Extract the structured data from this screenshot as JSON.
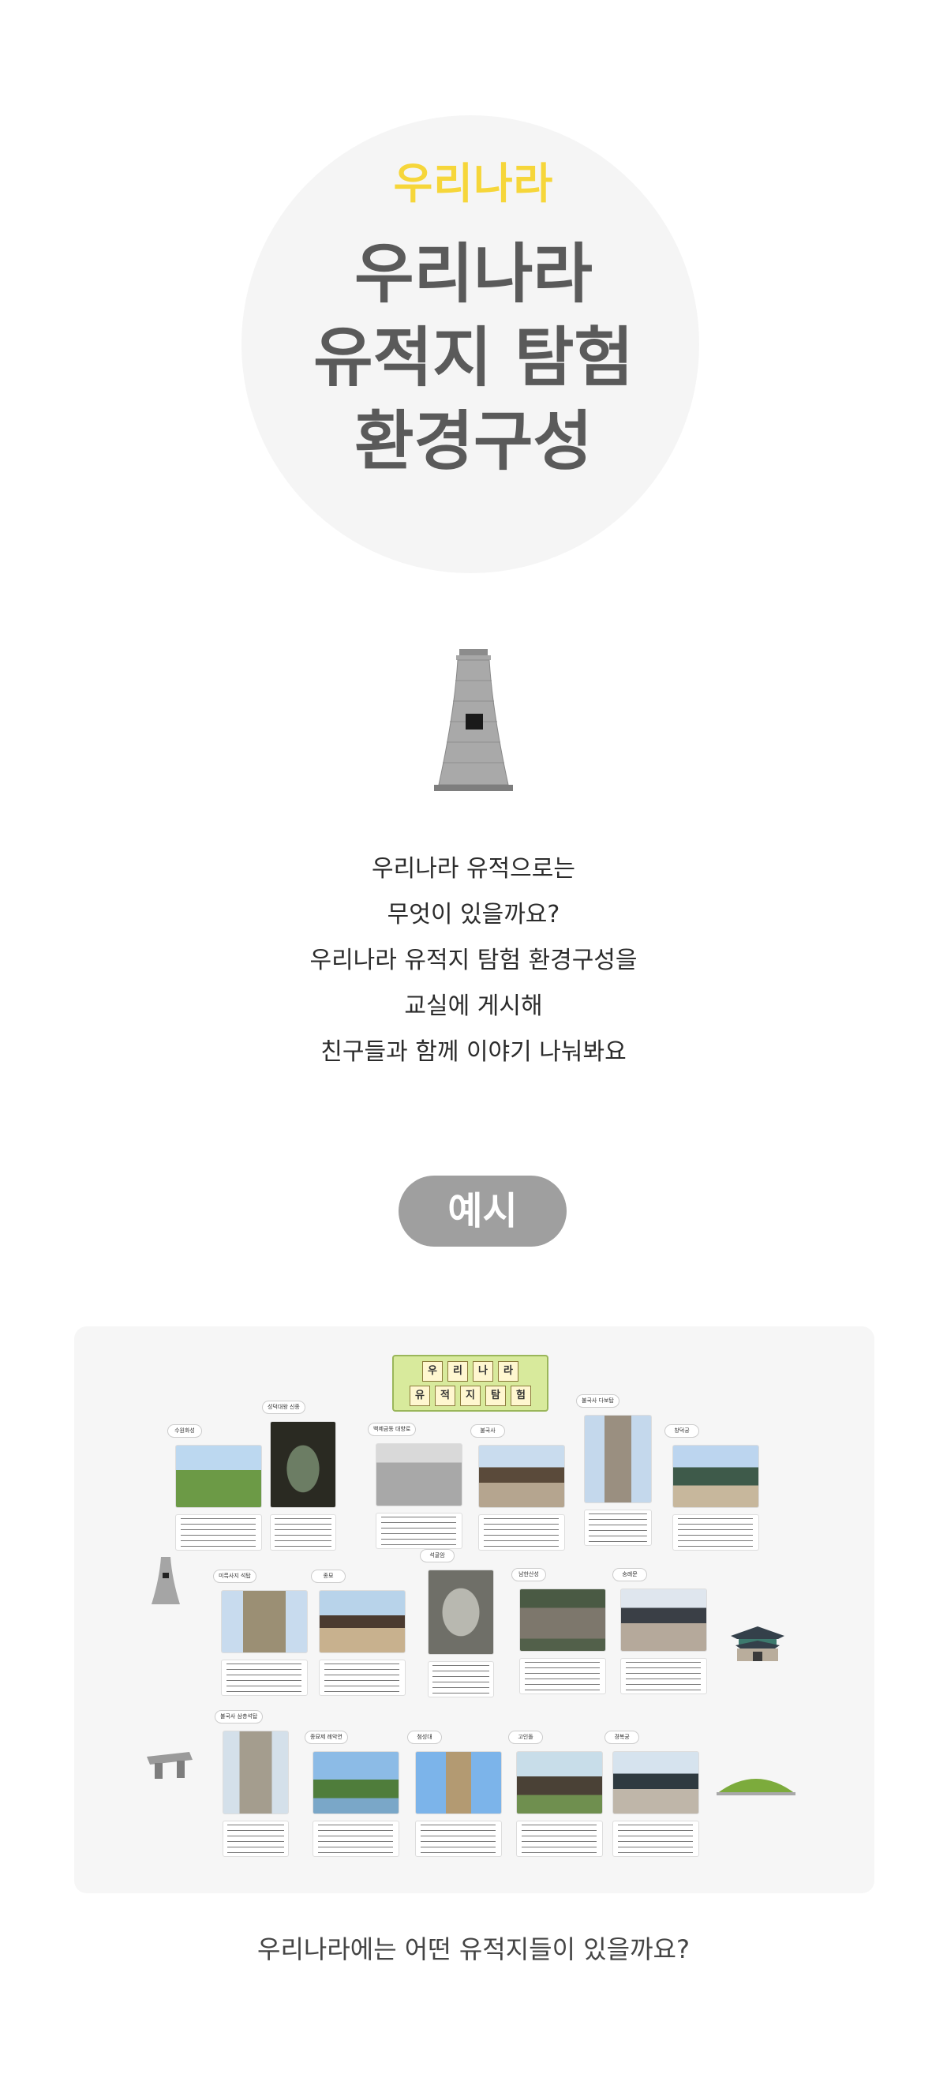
{
  "hero": {
    "subtitle": "우리나라",
    "title_lines": [
      "우리나라",
      "유적지 탐험",
      "환경구성"
    ]
  },
  "intro_lines": [
    "우리나라 유적으로는",
    "무엇이 있을까요?",
    "우리나라 유적지 탐험 환경구성을",
    "교실에 게시해",
    "친구들과 함께 이야기 나눠봐요"
  ],
  "example_label": "예시",
  "board": {
    "title_row1": [
      "우",
      "리",
      "나",
      "라"
    ],
    "title_row2": [
      "유",
      "적",
      "지",
      "탐",
      "험"
    ],
    "row1_tags": [
      "수원화성",
      "성덕대왕 신종",
      "백제금동 대향로",
      "불국사",
      "불국사 다보탑",
      "창덕궁"
    ],
    "row2_tags": [
      "미륵사지 석탑",
      "종묘",
      "석굴암",
      "남한산성",
      "숭례문"
    ],
    "row3_tags": [
      "불국사 삼층석탑",
      "종묘제 례악연",
      "첨성대",
      "고인돌",
      "경복궁"
    ]
  },
  "caption": "우리나라에는 어떤 유적지들이 있을까요?",
  "colors": {
    "accent_yellow": "#f6d63a",
    "title_gray": "#5a5a5a",
    "pill_gray": "#9f9f9f",
    "hero_bg": "#f5f5f5"
  }
}
